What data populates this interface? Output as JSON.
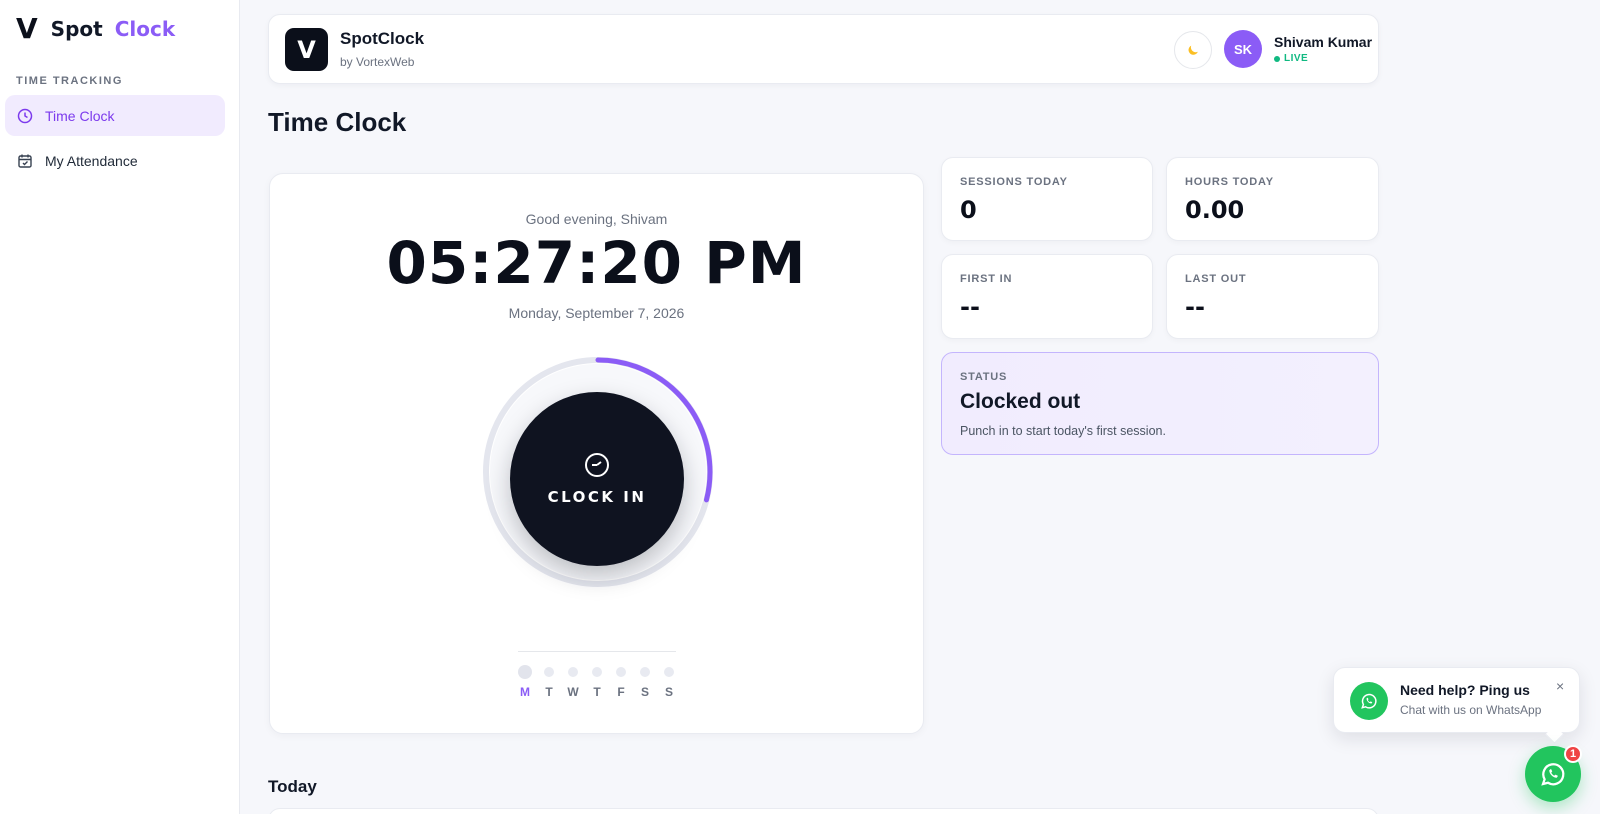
{
  "sidebar": {
    "brand_v": "V",
    "brand_spot": "Spot",
    "brand_clock": "Clock",
    "section": "TIME TRACKING",
    "items": [
      {
        "label": "Time Clock",
        "icon": "clock-icon",
        "active": true
      },
      {
        "label": "My Attendance",
        "icon": "calendar-icon",
        "active": false
      }
    ]
  },
  "header": {
    "logo": "V",
    "app_name": "SpotClock",
    "app_sub": "by VortexWeb",
    "theme_icon": "moon-icon",
    "avatar": "SK",
    "user_name": "Shivam Kumar",
    "live": "LIVE"
  },
  "page_title": "Time Clock",
  "clock": {
    "greeting": "Good evening, Shivam",
    "time": "05:27:20 PM",
    "date": "Monday, September 7, 2026",
    "button_label": "CLOCK IN",
    "progress_fraction": 0.29,
    "week": [
      "M",
      "T",
      "W",
      "T",
      "F",
      "S",
      "S"
    ],
    "today_index": 0
  },
  "stats": {
    "sessions_label": "SESSIONS TODAY",
    "sessions_value": "0",
    "hours_label": "HOURS TODAY",
    "hours_value": "0.00",
    "first_in_label": "FIRST IN",
    "first_in_value": "--",
    "last_out_label": "LAST OUT",
    "last_out_value": "--"
  },
  "status": {
    "label": "STATUS",
    "value": "Clocked out",
    "hint": "Punch in to start today's first session."
  },
  "today_title": "Today",
  "whatsapp": {
    "title": "Need help? Ping us",
    "subtitle": "Chat with us on WhatsApp",
    "close": "×",
    "badge": "1"
  },
  "colors": {
    "accent": "#8b5cf6",
    "dark": "#0f1320",
    "green": "#22c55e"
  }
}
